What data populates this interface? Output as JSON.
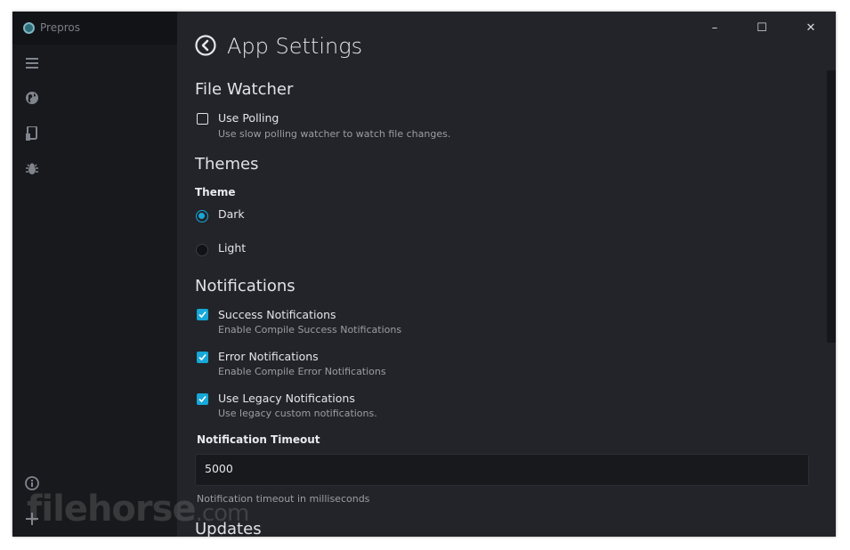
{
  "app": {
    "name": "Prepros"
  },
  "sidebar": {
    "items": [
      {
        "icon": "menu-icon"
      },
      {
        "icon": "globe-icon"
      },
      {
        "icon": "device-icon"
      },
      {
        "icon": "bug-icon"
      },
      {
        "icon": "info-icon"
      },
      {
        "icon": "plus-icon"
      }
    ]
  },
  "window_controls": {
    "minimize": "–",
    "maximize": "☐",
    "close": "✕"
  },
  "header": {
    "title": "App Settings"
  },
  "file_watcher": {
    "title": "File Watcher",
    "use_polling": {
      "label": "Use Polling",
      "help": "Use slow polling watcher to watch file changes.",
      "checked": false
    }
  },
  "themes": {
    "title": "Themes",
    "theme_label": "Theme",
    "options": [
      {
        "label": "Dark",
        "selected": true
      },
      {
        "label": "Light",
        "selected": false
      }
    ]
  },
  "notifications": {
    "title": "Notifications",
    "items": [
      {
        "label": "Success Notifications",
        "help": "Enable Compile Success Notifications",
        "checked": true
      },
      {
        "label": "Error Notifications",
        "help": "Enable Compile Error Notifications",
        "checked": true
      },
      {
        "label": "Use Legacy Notifications",
        "help": "Use legacy custom notifications.",
        "checked": true
      }
    ],
    "timeout_label": "Notification Timeout",
    "timeout_value": "5000",
    "timeout_help": "Notification timeout in milliseconds"
  },
  "updates": {
    "title": "Updates"
  },
  "watermark": {
    "text": "filehorse",
    "suffix": ".com"
  },
  "colors": {
    "accent": "#16a8d8",
    "background": "#222429",
    "sidebar": "#17191d"
  }
}
